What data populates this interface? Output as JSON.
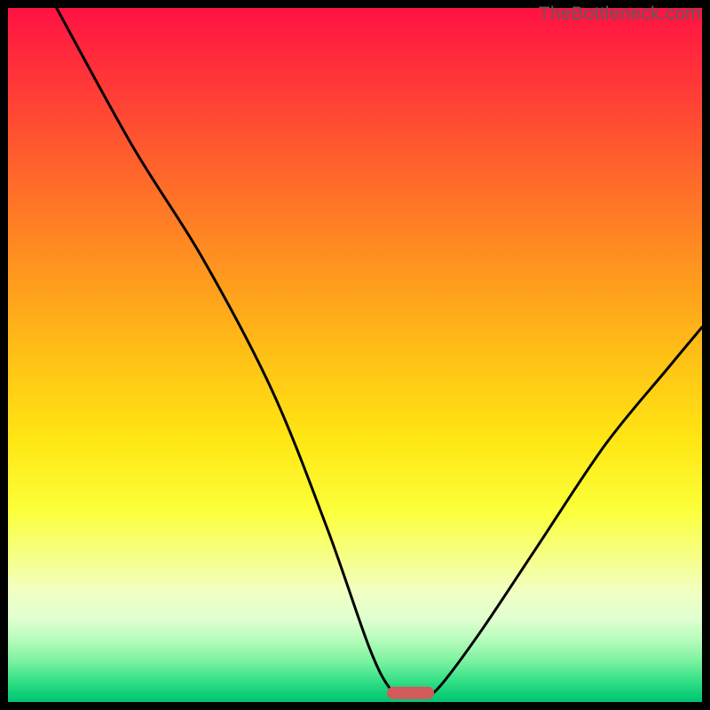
{
  "watermark": "TheBottleneck.com",
  "chart_data": {
    "type": "line",
    "title": "",
    "xlabel": "",
    "ylabel": "",
    "xlim": [
      0,
      100
    ],
    "ylim": [
      0,
      100
    ],
    "curve": [
      {
        "x": 7,
        "y": 100
      },
      {
        "x": 18,
        "y": 80
      },
      {
        "x": 28,
        "y": 64
      },
      {
        "x": 38,
        "y": 45
      },
      {
        "x": 46,
        "y": 25
      },
      {
        "x": 52,
        "y": 8
      },
      {
        "x": 55,
        "y": 2
      },
      {
        "x": 57,
        "y": 1.3
      },
      {
        "x": 60,
        "y": 1.3
      },
      {
        "x": 62,
        "y": 2
      },
      {
        "x": 68,
        "y": 10
      },
      {
        "x": 76,
        "y": 22
      },
      {
        "x": 86,
        "y": 37
      },
      {
        "x": 95,
        "y": 48
      },
      {
        "x": 100,
        "y": 54
      }
    ],
    "marker": {
      "x1": 55.5,
      "x2": 60.5,
      "y": 1.3,
      "color": "#d15a5a",
      "thickness": 1.8
    },
    "gradient_stops": [
      {
        "offset": 0.0,
        "color": "#ff1243"
      },
      {
        "offset": 0.125,
        "color": "#ff3e36"
      },
      {
        "offset": 0.25,
        "color": "#ff6a2a"
      },
      {
        "offset": 0.375,
        "color": "#ff951f"
      },
      {
        "offset": 0.5,
        "color": "#ffc016"
      },
      {
        "offset": 0.625,
        "color": "#ffe714"
      },
      {
        "offset": 0.725,
        "color": "#fbff3b"
      },
      {
        "offset": 0.79,
        "color": "#f6ff86"
      },
      {
        "offset": 0.84,
        "color": "#f1ffc2"
      },
      {
        "offset": 0.88,
        "color": "#e0ffd0"
      },
      {
        "offset": 0.91,
        "color": "#b7fcbb"
      },
      {
        "offset": 0.94,
        "color": "#7ef2a1"
      },
      {
        "offset": 0.965,
        "color": "#3fe38b"
      },
      {
        "offset": 0.985,
        "color": "#14d27a"
      },
      {
        "offset": 1.0,
        "color": "#00c471"
      }
    ]
  }
}
